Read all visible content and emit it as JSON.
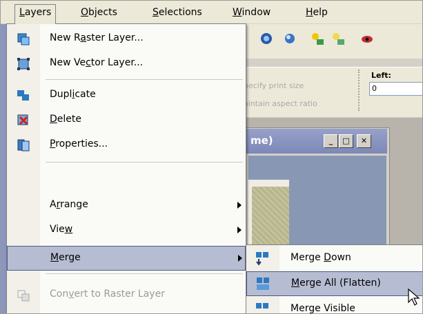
{
  "menubar": {
    "items": [
      {
        "label": "Layers",
        "key": "L",
        "rest": "ayers"
      },
      {
        "label": "Objects",
        "key": "O",
        "rest": "bjects"
      },
      {
        "label": "Selections",
        "key": "S",
        "rest": "elections"
      },
      {
        "label": "Window",
        "key": "W",
        "rest": "indow"
      },
      {
        "label": "Help",
        "key": "H",
        "rest": "elp"
      }
    ]
  },
  "options": {
    "print_size": "pecify print size",
    "aspect": "aintain aspect ratio",
    "left_label": "Left:",
    "left_value": "0"
  },
  "document": {
    "title": "me)",
    "min": "_",
    "max": "□",
    "close": "✕"
  },
  "layers_menu": {
    "new_raster": {
      "pre": "New R",
      "key": "a",
      "post": "ster Layer..."
    },
    "new_vector": {
      "pre": "New Ve",
      "key": "c",
      "post": "tor Layer..."
    },
    "duplicate": {
      "pre": "Dupl",
      "key": "i",
      "post": "cate"
    },
    "delete": {
      "pre": "",
      "key": "D",
      "post": "elete"
    },
    "properties": {
      "pre": "",
      "key": "P",
      "post": "roperties..."
    },
    "arrange": {
      "pre": "A",
      "key": "r",
      "post": "range"
    },
    "view": {
      "pre": "Vie",
      "key": "w",
      "post": ""
    },
    "merge": {
      "pre": "",
      "key": "M",
      "post": "erge"
    },
    "convert": {
      "pre": "Con",
      "key": "v",
      "post": "ert to Raster Layer"
    }
  },
  "merge_submenu": {
    "merge_down": {
      "pre": "Merge ",
      "key": "D",
      "post": "own"
    },
    "merge_all": {
      "pre": "",
      "key": "M",
      "post": "erge All (Flatten)"
    },
    "merge_visible": {
      "pre": "Merge Visible",
      "key": "",
      "post": ""
    }
  },
  "colors": {
    "menu_highlight": "#b6bdd2",
    "highlight_border": "#4a5a86",
    "menubar_bg": "#ece9d8",
    "title_bar": "#7d88b8"
  }
}
